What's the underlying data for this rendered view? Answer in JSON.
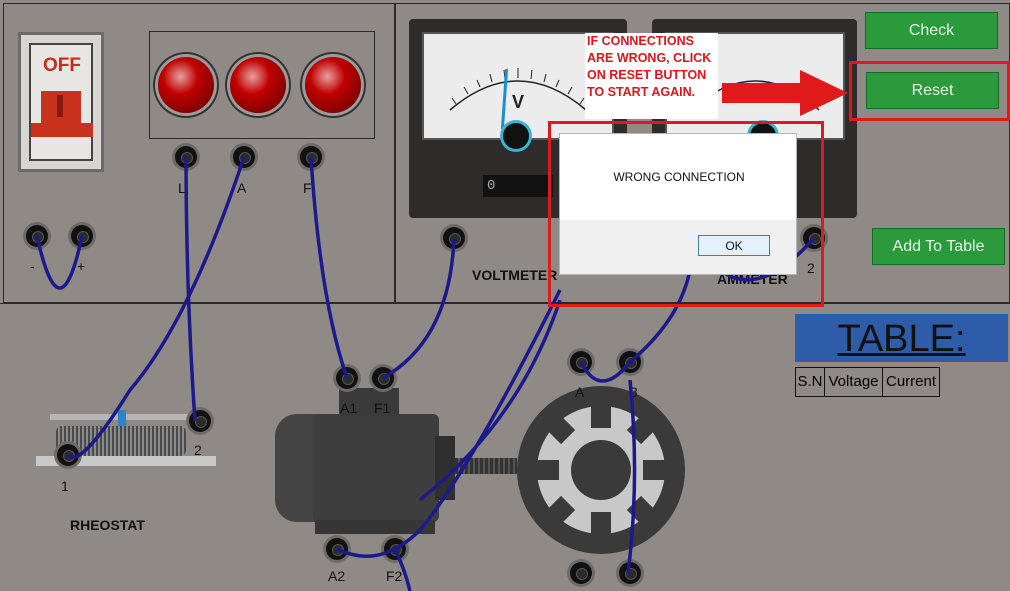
{
  "switch": {
    "label": "OFF"
  },
  "supply_terminals": {
    "minus": "-",
    "plus": "+"
  },
  "lamp_terminals": {
    "l": "L",
    "a": "A",
    "f": "F"
  },
  "meters": {
    "voltmeter_label": "VOLTMETER",
    "ammeter_label": "AMMETER",
    "voltmeter_reading": "0",
    "ammeter_terminal_2": "2"
  },
  "instruction": {
    "text": "IF CONNECTIONS ARE WRONG, CLICK ON RESET BUTTON TO START AGAIN."
  },
  "buttons": {
    "check": "Check",
    "reset": "Reset",
    "add_to_table": "Add To Table"
  },
  "dialog": {
    "message": "WRONG CONNECTION",
    "ok": "OK"
  },
  "table": {
    "title": "TABLE:",
    "columns": [
      "S.N",
      "Voltage",
      "Current"
    ]
  },
  "rheostat": {
    "label": "RHEOSTAT",
    "t1": "1",
    "t2": "2"
  },
  "motor": {
    "a1": "A1",
    "f1": "F1",
    "a2": "A2",
    "f2": "F2"
  },
  "generator": {
    "a": "A",
    "t3": "3"
  },
  "colors": {
    "wire": "#1c1a8a",
    "button": "#2b9a3c",
    "highlight": "#e01a1a",
    "table_header": "#2e5ca8"
  }
}
